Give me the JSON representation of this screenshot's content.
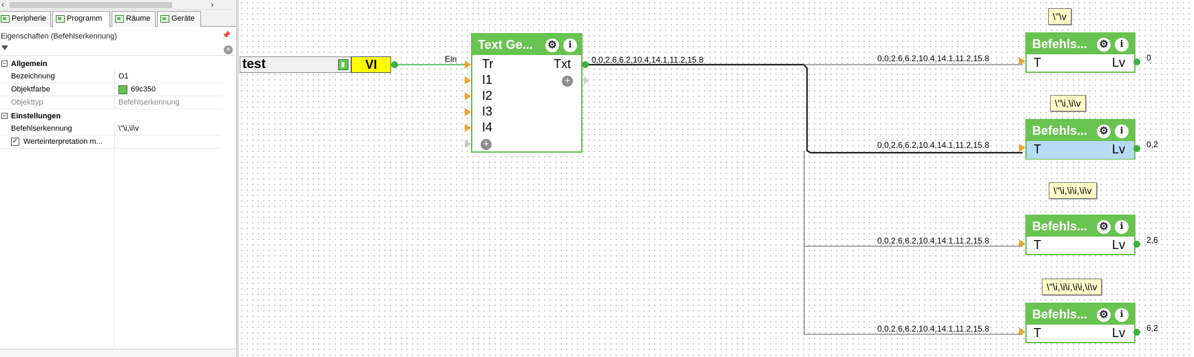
{
  "tabs": [
    {
      "label": "Peripherie",
      "active": false
    },
    {
      "label": "Programm",
      "active": true
    },
    {
      "label": "Räume",
      "active": false
    },
    {
      "label": "Geräte",
      "active": false
    }
  ],
  "properties": {
    "title": "Eigenschaften (Befehlserkennung)",
    "groups": {
      "general": "Allgemein",
      "settings": "Einstellungen"
    },
    "rows": {
      "bezeichnung": {
        "key": "Bezeichnung",
        "value": "O1"
      },
      "objektfarbe": {
        "key": "Objektfarbe",
        "value": "69c350",
        "color": "#69c350"
      },
      "objekttyp": {
        "key": "Objekttyp",
        "value": "Befehlserkennung"
      },
      "befehlserkennung": {
        "key": "Befehlserkennung",
        "value": "\\\"\\i,\\i\\v"
      },
      "werteinterpretation": {
        "key": "Werteinterpretation m...",
        "checked": true
      }
    }
  },
  "canvas": {
    "input": {
      "name": "test",
      "type_label": "VI",
      "out_label": "Ein"
    },
    "text_generator": {
      "title": "Text Ge...",
      "inputs": [
        "Tr",
        "I1",
        "I2",
        "I3",
        "I4"
      ],
      "output": "Txt",
      "output_value": "0,0,2.6,6.2,10.4,14.1,11.2,15.8"
    },
    "blocks": [
      {
        "title": "Befehls...",
        "input": "T",
        "output": "Lv",
        "wire_value": "0,0,2.6,6.2,10.4,14.1,11.2,15.8",
        "result": "0",
        "note": "\\\"\\v",
        "highlight": false
      },
      {
        "title": "Befehls...",
        "input": "T",
        "output": "Lv",
        "wire_value": "0,0,2.6,6.2,10.4,14.1,11.2,15.8",
        "result": "0,2",
        "note": "\\\"\\i,\\i\\v",
        "highlight": true
      },
      {
        "title": "Befehls...",
        "input": "T",
        "output": "Lv",
        "wire_value": "0,0,2.6,6.2,10.4,14.1,11.2,15.8",
        "result": "2,6",
        "note": "\\\"\\i,\\i\\i,\\i\\v",
        "highlight": false
      },
      {
        "title": "Befehls...",
        "input": "T",
        "output": "Lv",
        "wire_value": "0,0,2.6,6.2,10.4,14.1,11.2,15.8",
        "result": "6,2",
        "note": "\\\"\\i,\\i\\i,\\i\\i,\\i\\v",
        "highlight": false
      }
    ]
  },
  "icons": {
    "gear": "⚙",
    "info": "i",
    "plus": "+",
    "clear": "×",
    "filter": "filter-icon",
    "pin": "pin-icon"
  },
  "colors": {
    "block_green": "#69c350",
    "pin_orange": "#f0a030",
    "vi_yellow": "#ffff00",
    "highlight_blue": "#b7dbf5",
    "note_yellow": "#ffffcc"
  }
}
